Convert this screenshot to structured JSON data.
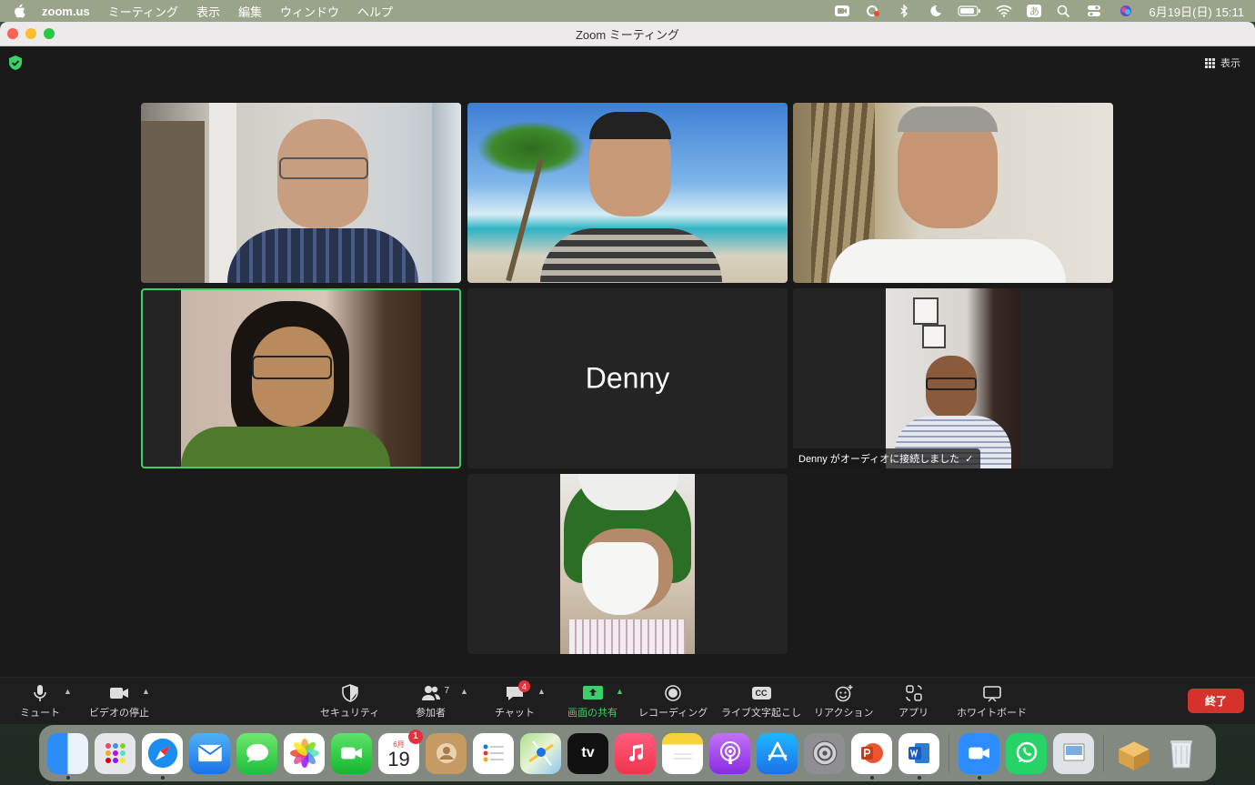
{
  "menubar": {
    "app_name": "zoom.us",
    "items": [
      "ミーティング",
      "表示",
      "編集",
      "ウィンドウ",
      "ヘルプ"
    ],
    "input_method": "あ",
    "clock": "6月19日(日)  15:11"
  },
  "window": {
    "title": "Zoom ミーティング",
    "view_label": "表示"
  },
  "tiles": {
    "denny_name": "Denny",
    "audio_notice": "Denny がオーディオに接続しました",
    "audio_notice_check": "✓"
  },
  "toolbar": {
    "mute": "ミュート",
    "stop_video": "ビデオの停止",
    "security": "セキュリティ",
    "participants": "参加者",
    "participants_count": "7",
    "chat": "チャット",
    "chat_badge": "4",
    "share_screen": "画面の共有",
    "recording": "レコーディング",
    "live_caption": "ライブ文字起こし",
    "reactions": "リアクション",
    "apps": "アプリ",
    "whiteboard": "ホワイトボード",
    "end": "終了",
    "cc": "CC"
  },
  "dock": {
    "calendar_month": "6月",
    "calendar_day": "19",
    "calendar_badge": "1",
    "tv_label": "tv"
  },
  "colors": {
    "accent_green": "#3ad16a",
    "end_red": "#d6322c"
  }
}
